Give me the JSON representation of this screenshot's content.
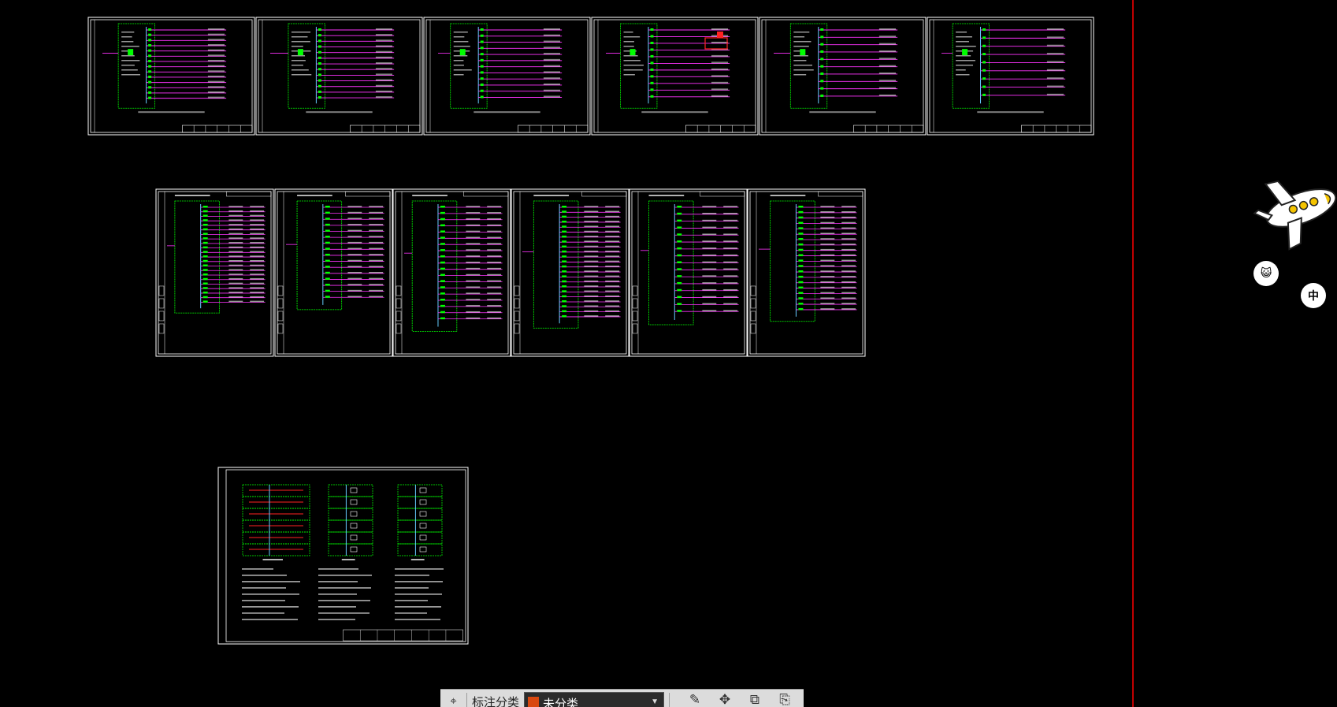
{
  "app": {
    "background": "#000000",
    "sheet_colors": {
      "frame": "#ffffff",
      "wire": "#ff33ff",
      "panel": "#00ff00",
      "bus": "#66ccff",
      "text": "#ffffff",
      "accent": "#ff2222"
    }
  },
  "drawing": {
    "row1_sheets": 6,
    "row2_sheets": 6,
    "row3_sheets": 1
  },
  "side_panel": {
    "divider_color": "#c00000",
    "mascot_icon": "airplane-mascot-icon",
    "cat_button_icon": "cat-face-icon",
    "cat_button_glyph": "😺",
    "lang_button_label": "中"
  },
  "toolbar": {
    "pin_icon": "annotation-pin-icon",
    "pin_glyph": "⌖",
    "category_label": "标注分类",
    "category_value": "未分类",
    "category_color": "#d9480f",
    "caret_glyph": "▼",
    "tools": [
      {
        "name": "edit-icon",
        "glyph": "✎"
      },
      {
        "name": "move-icon",
        "glyph": "✥"
      },
      {
        "name": "copy-icon",
        "glyph": "⧉"
      },
      {
        "name": "paste-icon",
        "glyph": "⎘"
      }
    ]
  }
}
